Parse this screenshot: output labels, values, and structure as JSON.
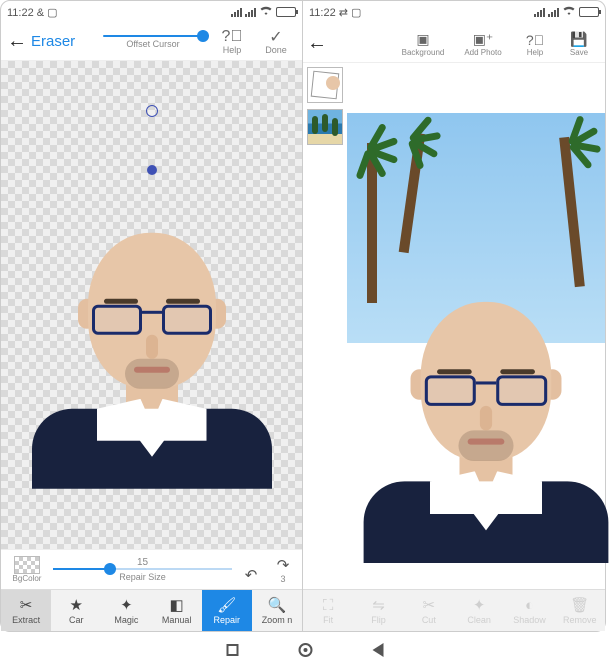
{
  "status": {
    "time": "11:22",
    "extra_left": "& ▢",
    "extra_left2": "⇄ ▢",
    "battery_pct": 60
  },
  "left": {
    "tool_title": "Eraser",
    "offset_label": "Offset Cursor",
    "help_label": "Help",
    "done_label": "Done",
    "secondary": {
      "bgcolor_label": "BgColor",
      "repair_value": "15",
      "repair_label": "Repair Size",
      "undo_count": "",
      "redo_count": "3"
    },
    "tabs": {
      "extract": "Extract",
      "auto": "Car",
      "magic": "Magic",
      "manual": "Manual",
      "repair": "Repair",
      "zoom": "Zoom n"
    }
  },
  "right": {
    "background_label": "Background",
    "addphoto_label": "Add Photo",
    "help_label": "Help",
    "save_label": "Save",
    "tabs": {
      "fit": "Fit",
      "flip": "Flip",
      "cut": "Cut",
      "clean": "Clean",
      "shadow": "Shadow",
      "remove": "Remove"
    }
  }
}
